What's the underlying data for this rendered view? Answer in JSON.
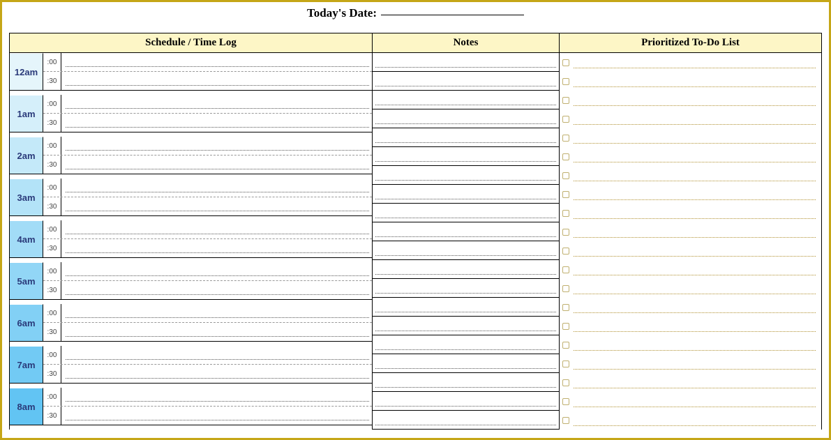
{
  "title": {
    "label": "Today's Date:"
  },
  "headers": {
    "schedule": "Schedule / Time Log",
    "notes": "Notes",
    "todo": "Prioritized To-Do List"
  },
  "schedule": {
    "hours": [
      {
        "label": "12am",
        "minutes": [
          ":00",
          ":30"
        ]
      },
      {
        "label": "1am",
        "minutes": [
          ":00",
          ":30"
        ]
      },
      {
        "label": "2am",
        "minutes": [
          ":00",
          ":30"
        ]
      },
      {
        "label": "3am",
        "minutes": [
          ":00",
          ":30"
        ]
      },
      {
        "label": "4am",
        "minutes": [
          ":00",
          ":30"
        ]
      },
      {
        "label": "5am",
        "minutes": [
          ":00",
          ":30"
        ]
      },
      {
        "label": "6am",
        "minutes": [
          ":00",
          ":30"
        ]
      },
      {
        "label": "7am",
        "minutes": [
          ":00",
          ":30"
        ]
      },
      {
        "label": "8am",
        "minutes": [
          ":00",
          ":30"
        ]
      }
    ]
  },
  "notes": {
    "line_count": 20
  },
  "todo": {
    "line_count": 20
  }
}
